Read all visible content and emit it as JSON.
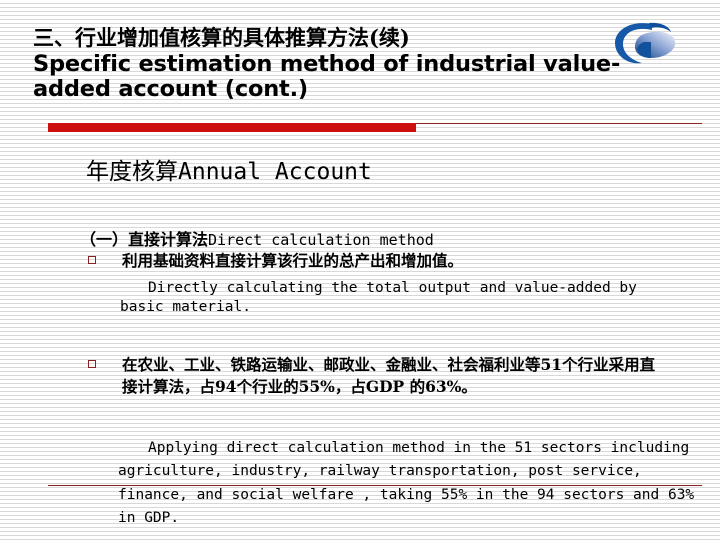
{
  "slide": {
    "title_cn": "三、行业增加值核算的具体推算方法(续)",
    "title_en": "Specific estimation method of industrial value-added account (cont.)",
    "logo_name": "swoosh-ellipse-logo",
    "accent_red": "#cc1010",
    "accent_maroon": "#8f2022",
    "background": "#ffffff"
  },
  "content": {
    "section_heading_cn": "年度核算",
    "section_heading_en": "Annual Account",
    "sub_heading_cn": "（一）直接计算法",
    "sub_heading_en": "Direct calculation method",
    "bullets": [
      {
        "marker": "hollow-square",
        "text_cn": "利用基础资料直接计算该行业的总产出和增加值。",
        "text_en": "Directly calculating the total output and value-added by basic material."
      },
      {
        "marker": "hollow-square",
        "text_cn": "在农业、工业、铁路运输业、邮政业、金融业、社会福利业等51个行业采用直接计算法，占94个行业的55%，占GDP 的63%。",
        "text_en": ""
      }
    ],
    "closing_en": "Applying direct calculation method in the 51 sectors including agriculture, industry, railway transportation, post service, finance, and social welfare , taking 55% in the 94 sectors and 63% in GDP."
  }
}
